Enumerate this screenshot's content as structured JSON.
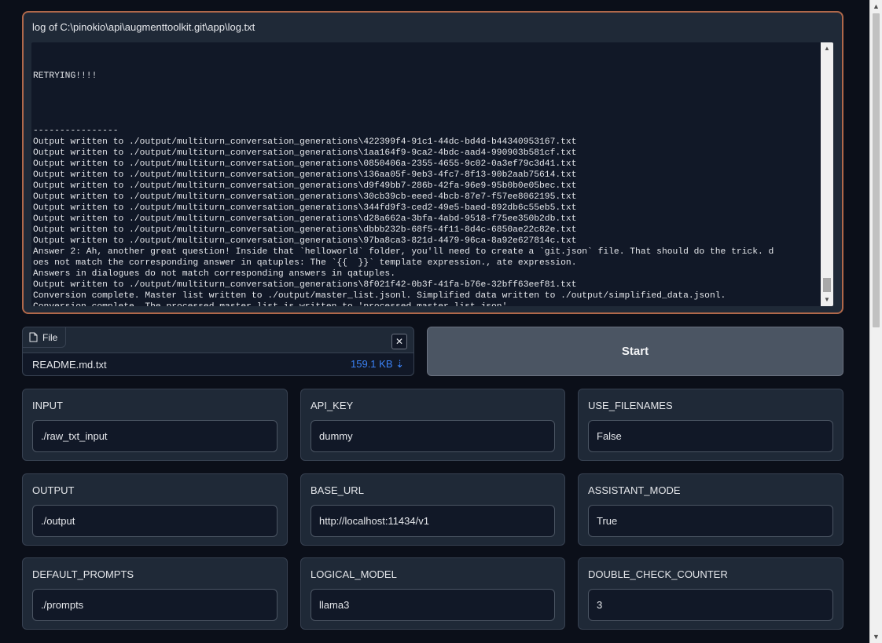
{
  "log": {
    "title": "log of C:\\pinokio\\api\\augmenttoolkit.git\\app\\log.txt",
    "lines": [
      "",
      "",
      "RETRYING!!!!",
      "",
      "",
      "",
      "",
      "----------------",
      "Output written to ./output/multiturn_conversation_generations\\422399f4-91c1-44dc-bd4d-b44340953167.txt",
      "Output written to ./output/multiturn_conversation_generations\\1aa164f9-9ca2-4bdc-aad4-990903b581cf.txt",
      "Output written to ./output/multiturn_conversation_generations\\0850406a-2355-4655-9c02-0a3ef79c3d41.txt",
      "Output written to ./output/multiturn_conversation_generations\\136aa05f-9eb3-4fc7-8f13-90b2aab75614.txt",
      "Output written to ./output/multiturn_conversation_generations\\d9f49bb7-286b-42fa-96e9-95b0b0e05bec.txt",
      "Output written to ./output/multiturn_conversation_generations\\30cb39cb-eeed-4bcb-87e7-f57ee8062195.txt",
      "Output written to ./output/multiturn_conversation_generations\\344fd9f3-ced2-49e5-baed-892db6c55eb5.txt",
      "Output written to ./output/multiturn_conversation_generations\\d28a662a-3bfa-4abd-9518-f75ee350b2db.txt",
      "Output written to ./output/multiturn_conversation_generations\\dbbb232b-68f5-4f11-8d4c-6850ae22c82e.txt",
      "Output written to ./output/multiturn_conversation_generations\\97ba8ca3-821d-4479-96ca-8a92e627814c.txt",
      "Answer 2: Ah, another great question! Inside that `helloworld` folder, you'll need to create a `git.json` file. That should do the trick. d",
      "oes not match the corresponding answer in qatuples: The `{{  }}` template expression., ate expression.",
      "Answers in dialogues do not match corresponding answers in qatuples.",
      "Output written to ./output/multiturn_conversation_generations\\8f021f42-0b3f-41fa-b76e-32bff63eef81.txt",
      "Conversion complete. Master list written to ./output/master_list.jsonl. Simplified data written to ./output/simplified_data.jsonl.",
      "Conversion complete. The processed master list is written to 'processed_master_list.json'."
    ]
  },
  "file": {
    "tab_label": "File",
    "name": "README.md.txt",
    "size": "159.1 KB ⇣",
    "clear_symbol": "✕"
  },
  "start_label": "Start",
  "fields": [
    {
      "label": "INPUT",
      "value": "./raw_txt_input"
    },
    {
      "label": "API_KEY",
      "value": "dummy"
    },
    {
      "label": "USE_FILENAMES",
      "value": "False"
    },
    {
      "label": "OUTPUT",
      "value": "./output"
    },
    {
      "label": "BASE_URL",
      "value": "http://localhost:11434/v1"
    },
    {
      "label": "ASSISTANT_MODE",
      "value": "True"
    },
    {
      "label": "DEFAULT_PROMPTS",
      "value": "./prompts"
    },
    {
      "label": "LOGICAL_MODEL",
      "value": "llama3"
    },
    {
      "label": "DOUBLE_CHECK_COUNTER",
      "value": "3"
    }
  ],
  "colors": {
    "background": "#0b0f19",
    "panel": "#1f2937",
    "log_border": "#b0684a",
    "file_size": "#3b82f6"
  },
  "icons": [
    "file-icon",
    "close-icon",
    "scroll-up-arrow-icon",
    "scroll-down-arrow-icon"
  ]
}
